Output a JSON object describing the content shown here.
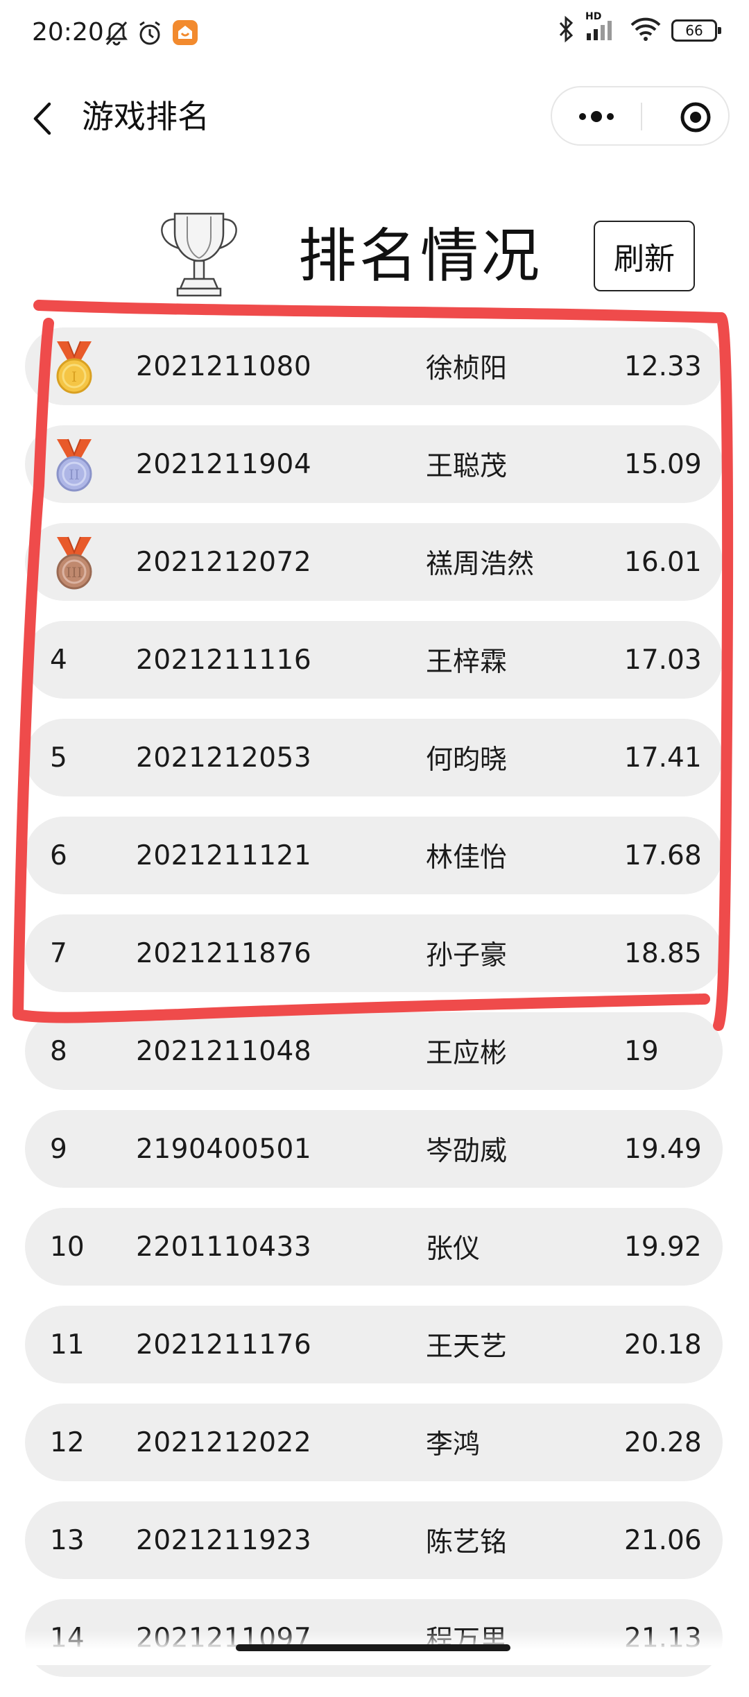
{
  "status_bar": {
    "time": "20:20",
    "battery": "66",
    "network_tag": "HD",
    "icons": [
      "mute-bell-icon",
      "alarm-icon",
      "app-notification-icon",
      "bluetooth-icon",
      "signal-icon",
      "wifi-icon",
      "battery-icon"
    ]
  },
  "nav": {
    "title": "游戏排名",
    "icons": [
      "back-arrow-icon",
      "more-icon",
      "close-target-icon"
    ]
  },
  "header": {
    "heading": "排名情况",
    "refresh_label": "刷新",
    "icon": "trophy-icon"
  },
  "colors": {
    "row_background": "#eeeeee",
    "annotation_red": "#ef4b4b",
    "gold": "#f5c545",
    "silver": "#aeb6e6",
    "bronze": "#c0896e",
    "ribbon": "#e85a2a"
  },
  "rankings": [
    {
      "rank": "1",
      "medal": "gold",
      "id": "2021211080",
      "name": "徐桢阳",
      "score": "12.33"
    },
    {
      "rank": "2",
      "medal": "silver",
      "id": "2021211904",
      "name": "王聪茂",
      "score": "15.09"
    },
    {
      "rank": "3",
      "medal": "bronze",
      "id": "2021212072",
      "name": "禚周浩然",
      "score": "16.01"
    },
    {
      "rank": "4",
      "medal": "",
      "id": "2021211116",
      "name": "王梓霖",
      "score": "17.03"
    },
    {
      "rank": "5",
      "medal": "",
      "id": "2021212053",
      "name": "何昀晓",
      "score": "17.41"
    },
    {
      "rank": "6",
      "medal": "",
      "id": "2021211121",
      "name": "林佳怡",
      "score": "17.68"
    },
    {
      "rank": "7",
      "medal": "",
      "id": "2021211876",
      "name": "孙子豪",
      "score": "18.85"
    },
    {
      "rank": "8",
      "medal": "",
      "id": "2021211048",
      "name": "王应彬",
      "score": "19"
    },
    {
      "rank": "9",
      "medal": "",
      "id": "2190400501",
      "name": "岑劭威",
      "score": "19.49"
    },
    {
      "rank": "10",
      "medal": "",
      "id": "2201110433",
      "name": "张仪",
      "score": "19.92"
    },
    {
      "rank": "11",
      "medal": "",
      "id": "2021211176",
      "name": "王天艺",
      "score": "20.18"
    },
    {
      "rank": "12",
      "medal": "",
      "id": "2021212022",
      "name": "李鸿",
      "score": "20.28"
    },
    {
      "rank": "13",
      "medal": "",
      "id": "2021211923",
      "name": "陈艺铭",
      "score": "21.06"
    },
    {
      "rank": "14",
      "medal": "",
      "id": "2021211097",
      "name": "程万里",
      "score": "21.13"
    }
  ]
}
